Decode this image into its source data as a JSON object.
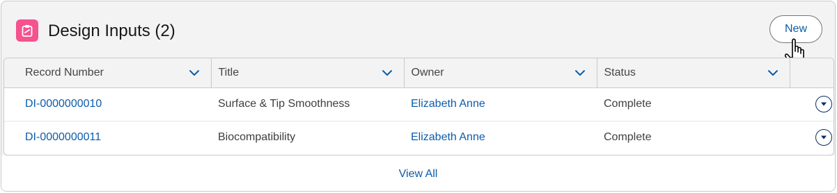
{
  "card": {
    "title": "Design Inputs (2)",
    "icon": "clipboard-icon",
    "icon_color": "#f5538d",
    "new_button_label": "New"
  },
  "table": {
    "columns": [
      "Record Number",
      "Title",
      "Owner",
      "Status"
    ],
    "rows": [
      {
        "record_number": "DI-0000000010",
        "title": "Surface & Tip Smoothness",
        "owner": "Elizabeth Anne",
        "status": "Complete"
      },
      {
        "record_number": "DI-0000000011",
        "title": "Biocompatibility",
        "owner": "Elizabeth Anne",
        "status": "Complete"
      }
    ]
  },
  "footer": {
    "view_all_label": "View All"
  },
  "colors": {
    "link": "#0b5cab",
    "header_bg": "#f3f3f3",
    "border": "#c9c9c9"
  }
}
